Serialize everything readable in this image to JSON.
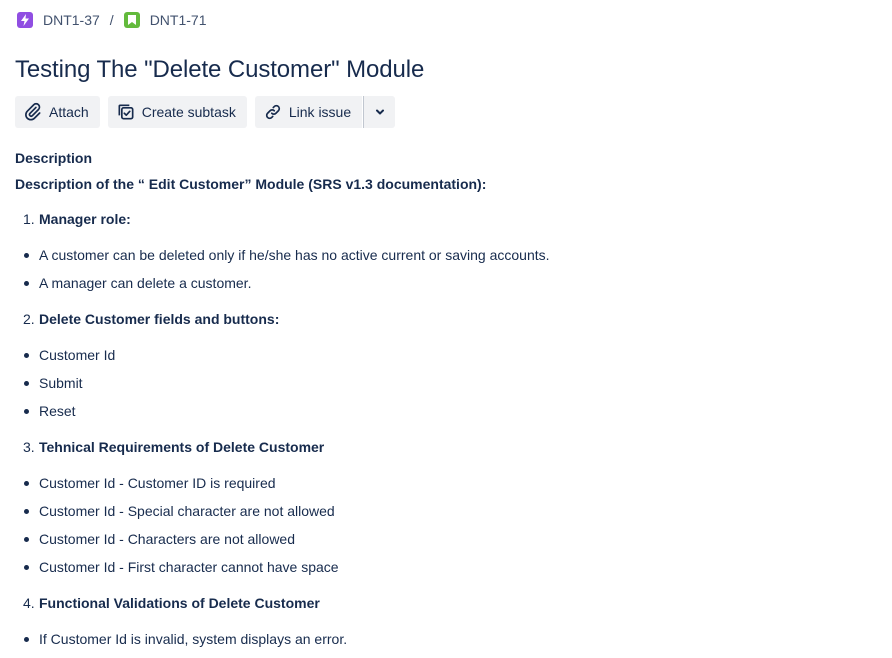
{
  "breadcrumb": {
    "parent": {
      "key": "DNT1-37",
      "icon": "epic-lightning-icon",
      "color": "#904ee2"
    },
    "separator": "/",
    "current": {
      "key": "DNT1-71",
      "icon": "story-bookmark-icon",
      "color": "#63ba3c"
    }
  },
  "issue": {
    "title": "Testing The \"Delete Customer\" Module"
  },
  "toolbar": {
    "attach_label": "Attach",
    "create_subtask_label": "Create subtask",
    "link_issue_label": "Link issue",
    "more_icon": "chevron-down-icon"
  },
  "description": {
    "heading": "Description",
    "intro": "Description of the “ Edit Customer” Module (SRS v1.3 documentation):",
    "sections": [
      {
        "number": "1.",
        "title": "Manager role:",
        "items": [
          "A customer can be deleted only if he/she has  no active current or saving accounts.",
          "A manager can delete a customer."
        ]
      },
      {
        "number": "2.",
        "title": "Delete Customer fields and buttons:",
        "items": [
          "Customer Id",
          "Submit",
          "Reset"
        ]
      },
      {
        "number": "3.",
        "title": "Tehnical Requirements of Delete Customer",
        "items": [
          "Customer Id - Customer ID is required",
          "Customer Id - Special character are not allowed",
          "Customer Id - Characters are not allowed",
          "Customer Id - First character cannot have space"
        ]
      },
      {
        "number": "4.",
        "title": "Functional Validations of Delete Customer",
        "items": [
          "If Customer Id is invalid, system displays an error."
        ]
      }
    ]
  }
}
